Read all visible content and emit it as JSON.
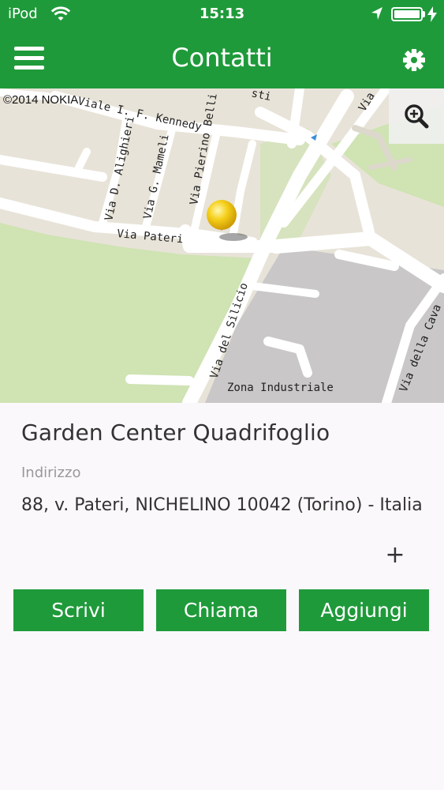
{
  "status_bar": {
    "carrier": "iPod",
    "time": "15:13",
    "battery_level": 1.0
  },
  "header": {
    "title": "Contatti",
    "menu_icon": "hamburger-menu-icon",
    "settings_icon": "gear-icon",
    "background_color": "#1f9a3a"
  },
  "map": {
    "copyright": "©2014 NOKIA",
    "zoom_icon": "zoom-in-icon",
    "pin_icon": "map-pin-icon",
    "street_labels": {
      "kennedy": "Viale I. F. Kennedy",
      "alighieri": "Via D. Alighieri",
      "mameli": "Via G. Mameli",
      "belli": "Via Pierino Belli",
      "pateri": "Via Pateri",
      "silicio": "Via del Silicio",
      "industrial": "Zona Industriale",
      "cava": "Via della Cava",
      "top_right": "Via lu",
      "top_fragment": "sti"
    }
  },
  "contact": {
    "name": "Garden Center Quadrifoglio",
    "address_label": "Indirizzo",
    "address": "88, v. Pateri, NICHELINO 10042 (Torino) - Italia",
    "expand_symbol": "+"
  },
  "actions": {
    "write": "Scrivi",
    "call": "Chiama",
    "add": "Aggiungi"
  }
}
